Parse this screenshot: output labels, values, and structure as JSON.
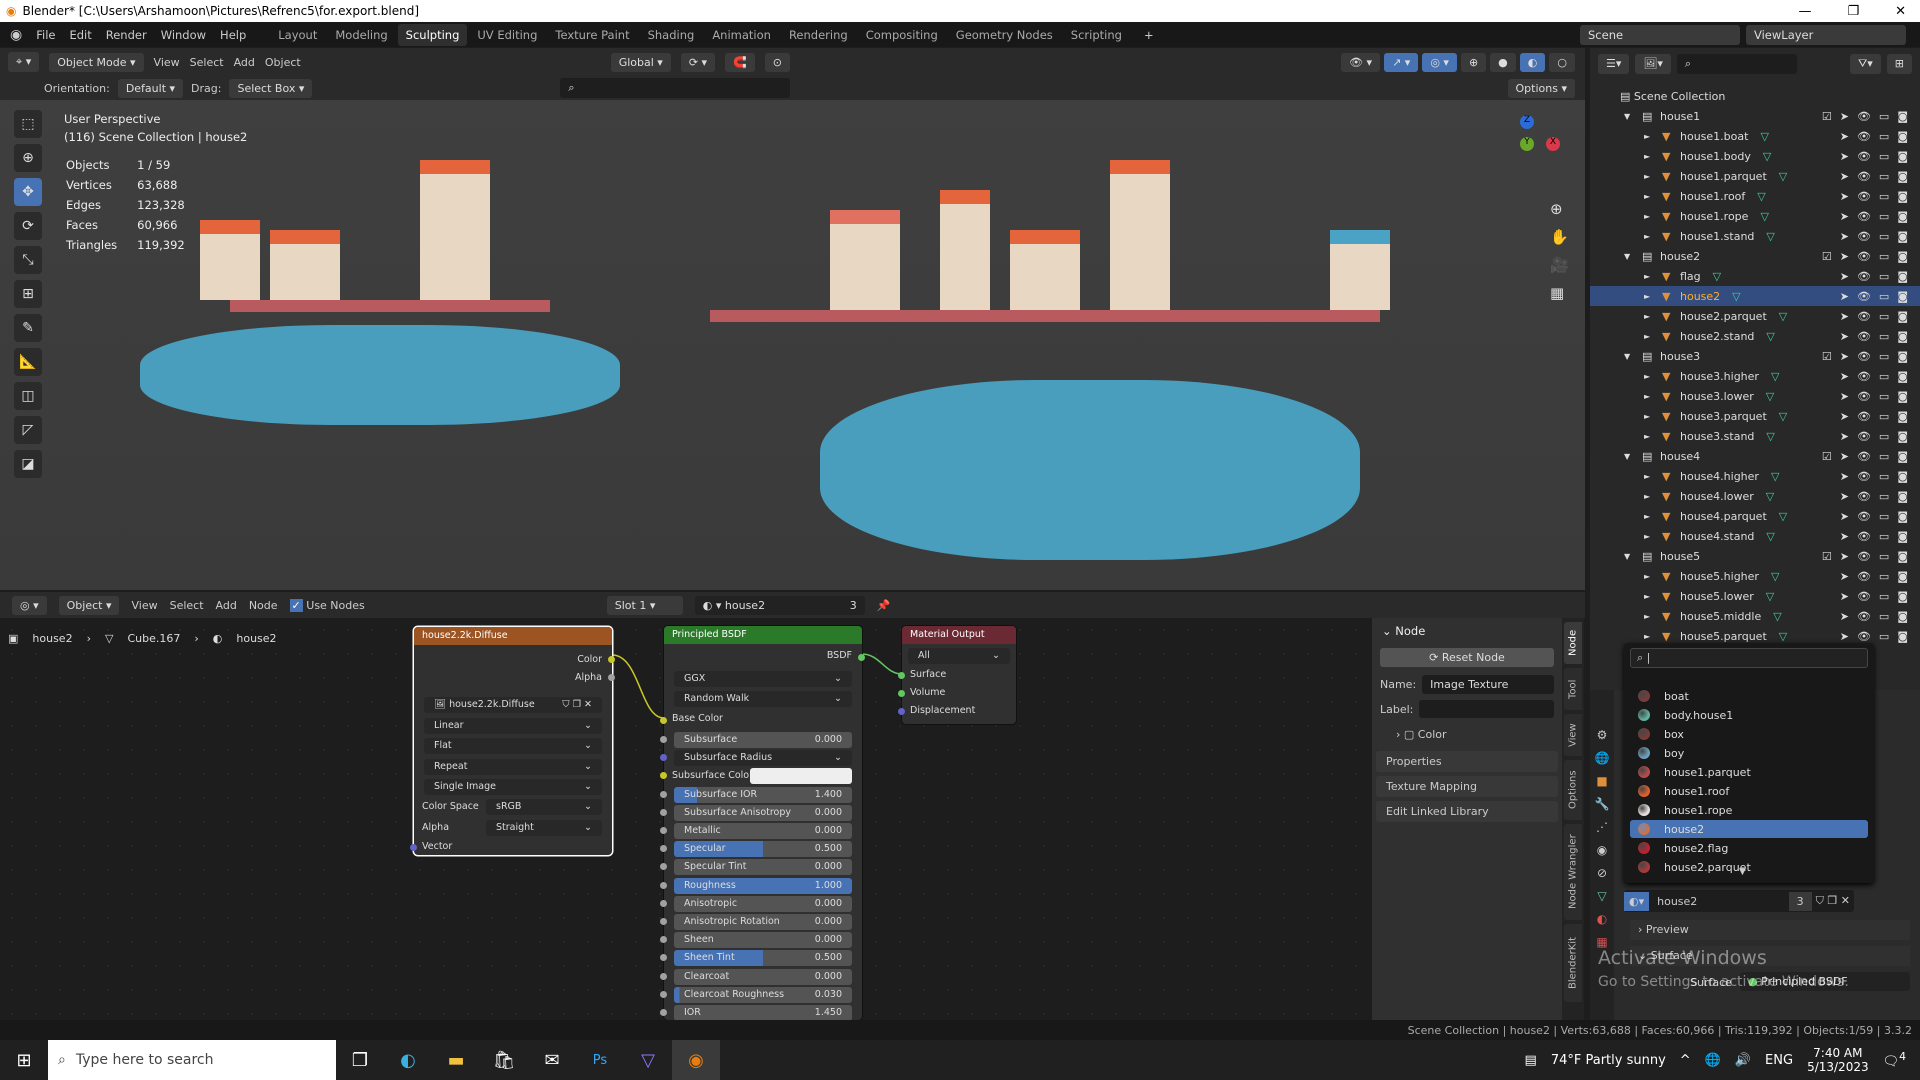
{
  "window": {
    "title": "Blender* [C:\\Users\\Arshamoon\\Pictures\\Refrenc5\\for.export.blend]",
    "controls": [
      "—",
      "❐",
      "✕"
    ]
  },
  "menu": [
    "File",
    "Edit",
    "Render",
    "Window",
    "Help"
  ],
  "workspaces": [
    "Layout",
    "Modeling",
    "Sculpting",
    "UV Editing",
    "Texture Paint",
    "Shading",
    "Animation",
    "Rendering",
    "Compositing",
    "Geometry Nodes",
    "Scripting"
  ],
  "active_workspace": "Sculpting",
  "scene": {
    "name": "Scene",
    "view_layer": "ViewLayer"
  },
  "viewport_header": {
    "mode": "Object Mode",
    "menus": [
      "View",
      "Select",
      "Add",
      "Object"
    ],
    "transform": "Global",
    "options": "Options"
  },
  "tool_settings": {
    "orientation_label": "Orientation:",
    "orientation": "Default",
    "drag_label": "Drag:",
    "drag": "Select Box"
  },
  "viewport": {
    "view": "User Perspective",
    "collection": "(116) Scene Collection | house2",
    "stats": [
      [
        "Objects",
        "1 / 59"
      ],
      [
        "Vertices",
        "63,688"
      ],
      [
        "Edges",
        "123,328"
      ],
      [
        "Faces",
        "60,966"
      ],
      [
        "Triangles",
        "119,392"
      ]
    ],
    "gizmo": {
      "z": "Z",
      "y": "Y",
      "x": "X"
    }
  },
  "node_header": {
    "type": "Object",
    "menus": [
      "View",
      "Select",
      "Add",
      "Node"
    ],
    "use_nodes": "Use Nodes",
    "slot": "Slot 1",
    "material": "house2",
    "users": "3"
  },
  "breadcrumb": [
    "house2",
    "Cube.167",
    "house2"
  ],
  "image_node": {
    "title": "house2.2k.Diffuse",
    "outputs": [
      "Color",
      "Alpha"
    ],
    "image": "house2.2k.Diffuse",
    "interpolation": "Linear",
    "projection": "Flat",
    "extension": "Repeat",
    "source": "Single Image",
    "color_space_label": "Color Space",
    "color_space": "sRGB",
    "alpha_label": "Alpha",
    "alpha": "Straight",
    "input": "Vector",
    "header_color": "#9c5422"
  },
  "bsdf_node": {
    "title": "Principled BSDF",
    "output": "BSDF",
    "distribution": "GGX",
    "subsurface_method": "Random Walk",
    "base_color": "Base Color",
    "subsurface_color": "Subsurface Color",
    "subsurface_radius": "Subsurface Radius",
    "header_color": "#2a7a2a",
    "fields": [
      {
        "label": "Subsurface",
        "value": "0.000",
        "fill": 0
      },
      {
        "label": "Subsurface IOR",
        "value": "1.400",
        "fill": 0.13
      },
      {
        "label": "Subsurface Anisotropy",
        "value": "0.000",
        "fill": 0
      },
      {
        "label": "Metallic",
        "value": "0.000",
        "fill": 0
      },
      {
        "label": "Specular",
        "value": "0.500",
        "fill": 0.5
      },
      {
        "label": "Specular Tint",
        "value": "0.000",
        "fill": 0
      },
      {
        "label": "Roughness",
        "value": "1.000",
        "fill": 1
      },
      {
        "label": "Anisotropic",
        "value": "0.000",
        "fill": 0
      },
      {
        "label": "Anisotropic Rotation",
        "value": "0.000",
        "fill": 0
      },
      {
        "label": "Sheen",
        "value": "0.000",
        "fill": 0
      },
      {
        "label": "Sheen Tint",
        "value": "0.500",
        "fill": 0.5
      },
      {
        "label": "Clearcoat",
        "value": "0.000",
        "fill": 0
      },
      {
        "label": "Clearcoat Roughness",
        "value": "0.030",
        "fill": 0.03
      },
      {
        "label": "IOR",
        "value": "1.450",
        "fill": 0
      }
    ]
  },
  "output_node": {
    "title": "Material Output",
    "target": "All",
    "inputs": [
      "Surface",
      "Volume",
      "Displacement"
    ],
    "header_color": "#6b2a33"
  },
  "npanel": {
    "section": "Node",
    "reset": "Reset Node",
    "name_label": "Name:",
    "name": "Image Texture",
    "label_label": "Label:",
    "label": "",
    "color": "Color",
    "sections": [
      "Properties",
      "Texture Mapping",
      "Edit Linked Library"
    ],
    "tabs": [
      "Node",
      "Tool",
      "View",
      "Options",
      "Node Wrangler",
      "BlenderKit"
    ]
  },
  "outliner": {
    "root": "Scene Collection",
    "rows": [
      {
        "name": "house1",
        "kind": "collection"
      },
      {
        "name": "house1.boat",
        "kind": "mesh"
      },
      {
        "name": "house1.body",
        "kind": "mesh"
      },
      {
        "name": "house1.parquet",
        "kind": "mesh"
      },
      {
        "name": "house1.roof",
        "kind": "mesh"
      },
      {
        "name": "house1.rope",
        "kind": "mesh"
      },
      {
        "name": "house1.stand",
        "kind": "mesh"
      },
      {
        "name": "house2",
        "kind": "collection"
      },
      {
        "name": "flag",
        "kind": "mesh"
      },
      {
        "name": "house2",
        "kind": "mesh",
        "selected": true
      },
      {
        "name": "house2.parquet",
        "kind": "mesh"
      },
      {
        "name": "house2.stand",
        "kind": "mesh"
      },
      {
        "name": "house3",
        "kind": "collection"
      },
      {
        "name": "house3.higher",
        "kind": "mesh"
      },
      {
        "name": "house3.lower",
        "kind": "mesh"
      },
      {
        "name": "house3.parquet",
        "kind": "mesh"
      },
      {
        "name": "house3.stand",
        "kind": "mesh"
      },
      {
        "name": "house4",
        "kind": "collection"
      },
      {
        "name": "house4.higher",
        "kind": "mesh"
      },
      {
        "name": "house4.lower",
        "kind": "mesh"
      },
      {
        "name": "house4.parquet",
        "kind": "mesh"
      },
      {
        "name": "house4.stand",
        "kind": "mesh"
      },
      {
        "name": "house5",
        "kind": "collection"
      },
      {
        "name": "house5.higher",
        "kind": "mesh"
      },
      {
        "name": "house5.lower",
        "kind": "mesh"
      },
      {
        "name": "house5.middle",
        "kind": "mesh"
      },
      {
        "name": "house5.parquet",
        "kind": "mesh"
      }
    ]
  },
  "material_list": [
    {
      "name": "boat",
      "color": "#7a3b3b"
    },
    {
      "name": "body.house1",
      "color": "#5fb3a0"
    },
    {
      "name": "box",
      "color": "#7a3b3b"
    },
    {
      "name": "boy",
      "color": "#6aa0c0"
    },
    {
      "name": "house1.parquet",
      "color": "#b84a4a"
    },
    {
      "name": "house1.roof",
      "color": "#e0602a"
    },
    {
      "name": "house1.rope",
      "color": "#e8e0e0"
    },
    {
      "name": "house2",
      "color": "#d07040",
      "selected": true
    },
    {
      "name": "house2.flag",
      "color": "#c02030"
    },
    {
      "name": "house2.parquet",
      "color": "#a83a3a"
    }
  ],
  "properties": {
    "material": "house2",
    "users": "3",
    "preview": "Preview",
    "surface_section": "Surface",
    "surface_label": "Surface",
    "surface_value": "Principled BSDF"
  },
  "statusbar": "Scene Collection | house2 | Verts:63,688 | Faces:60,966 | Tris:119,392 | Objects:1/59 | 3.3.2",
  "watermark": {
    "line1": "Activate Windows",
    "line2": "Go to Settings to activate Windows."
  },
  "taskbar": {
    "search_placeholder": "Type here to search",
    "weather": "74°F  Partly sunny",
    "lang": "ENG",
    "time": "7:40 AM",
    "date": "5/13/2023",
    "notifications": "4"
  },
  "colors": {
    "accent": "#4772b3",
    "selection": "#334d80"
  }
}
